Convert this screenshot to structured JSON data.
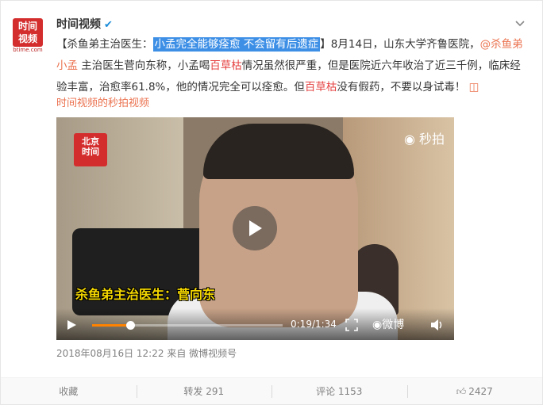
{
  "post": {
    "author": "时间视频",
    "avatar_top": "时间\n视频",
    "avatar_sub": "btime.com",
    "text_bracket_open": "【杀鱼弟主治医生：",
    "text_highlight": "小孟完全能够痊愈 不会留有后遗症",
    "text_after_bracket": "】8月14日，山东大学齐鲁医院，",
    "mention": "@杀鱼弟小孟",
    "text_2": " 主治医生菅向东称，小孟喝",
    "keyword": "百草枯",
    "text_3": "情况虽然很严重，但是医院近六年收治了近三千例，临床经验丰富，治愈率61.8%，他的情况完全可以痊愈。但",
    "keyword2": "百草枯",
    "text_4": "没有假药，不要以身试毒！",
    "source_link": "时间视频的秒拍视频",
    "timestamp": "2018年08月16日 12:22",
    "from": "来自 微博视频号"
  },
  "video": {
    "logo_text": "北京\n时间",
    "logo_sub": "btime.com",
    "brand": "秒拍",
    "caption": "杀鱼弟主治医生：菅向东",
    "time": "0:19/1:34",
    "weibo": "微博",
    "progress": 0.2
  },
  "actions": {
    "favorite": "收藏",
    "repost": "转发 291",
    "comment": "评论 1153",
    "like": "2427"
  },
  "colors": {
    "accent": "#eb7350",
    "highlight": "#3d8fe6",
    "red": "#e64141"
  }
}
